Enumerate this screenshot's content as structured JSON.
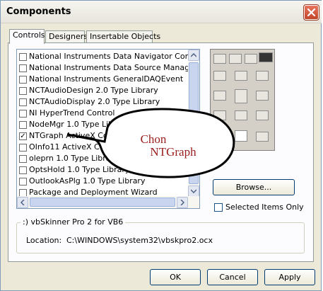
{
  "window": {
    "title": "Components"
  },
  "tabs": [
    {
      "label": "Controls"
    },
    {
      "label": "Designers"
    },
    {
      "label": "Insertable Objects"
    }
  ],
  "controls_list": [
    {
      "label": "National Instruments Data Navigator Control - N",
      "checked": false
    },
    {
      "label": "National Instruments Data Source Manager Cor",
      "checked": false
    },
    {
      "label": "National Instruments GeneralDAQEvent",
      "checked": false
    },
    {
      "label": "NCTAudioDesign 2.0 Type Library",
      "checked": false
    },
    {
      "label": "NCTAudioDisplay 2.0 Type Library",
      "checked": false
    },
    {
      "label": "NI HyperTrend Control",
      "checked": false
    },
    {
      "label": "NodeMgr 1.0 Type Library",
      "checked": false
    },
    {
      "label": "NTGraph ActiveX Control module",
      "checked": true
    },
    {
      "label": "OInfo11 ActiveX Control module",
      "checked": false
    },
    {
      "label": "oleprn 1.0 Type Library",
      "checked": false
    },
    {
      "label": "OptsHold 1.0 Type Library",
      "checked": false
    },
    {
      "label": "OutlookAsPlg 1.0 Type Library",
      "checked": false
    },
    {
      "label": "Package and Deployment Wizard",
      "checked": false
    }
  ],
  "buttons": {
    "browse": "Browse...",
    "ok": "OK",
    "cancel": "Cancel",
    "apply": "Apply"
  },
  "selected_items_only": {
    "label": "Selected Items Only",
    "checked": false
  },
  "group": {
    "title": ":) vbSkinner Pro 2 for VB6",
    "location_label": "Location:",
    "location_value": "C:\\WINDOWS\\system32\\vbskpro2.ocx"
  },
  "annotation": {
    "line1": "Chon",
    "line2": "NTGraph"
  },
  "colors": {
    "dialog_bg": "#ece9d8",
    "close_button": "#c24528",
    "annotation_text": "#9b1c1c"
  }
}
